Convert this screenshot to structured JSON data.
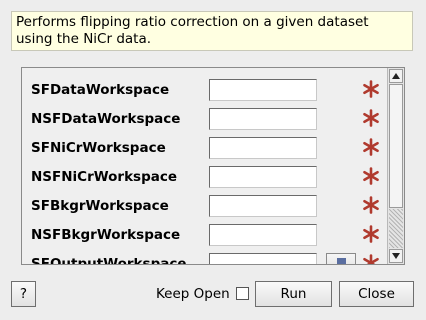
{
  "description": "Performs flipping ratio correction on a given dataset using the NiCr data.",
  "properties": [
    {
      "label": "SFDataWorkspace",
      "value": "",
      "required": true,
      "has_browse": false
    },
    {
      "label": "NSFDataWorkspace",
      "value": "",
      "required": true,
      "has_browse": false
    },
    {
      "label": "SFNiCrWorkspace",
      "value": "",
      "required": true,
      "has_browse": false
    },
    {
      "label": "NSFNiCrWorkspace",
      "value": "",
      "required": true,
      "has_browse": false
    },
    {
      "label": "SFBkgrWorkspace",
      "value": "",
      "required": true,
      "has_browse": false
    },
    {
      "label": "NSFBkgrWorkspace",
      "value": "",
      "required": true,
      "has_browse": false
    },
    {
      "label": "SFOutputWorkspace",
      "value": "",
      "required": true,
      "has_browse": true
    }
  ],
  "buttons": {
    "help": "?",
    "run": "Run",
    "close": "Close"
  },
  "keep_open": {
    "label": "Keep Open",
    "checked": false
  },
  "colors": {
    "required_star": "#b03a2e",
    "description_bg": "#ffffe1",
    "window_bg": "#ededed"
  },
  "icons": {
    "required": "asterisk-icon",
    "browse": "browse-icon",
    "scroll_up": "chevron-up-icon",
    "scroll_down": "chevron-down-icon"
  }
}
